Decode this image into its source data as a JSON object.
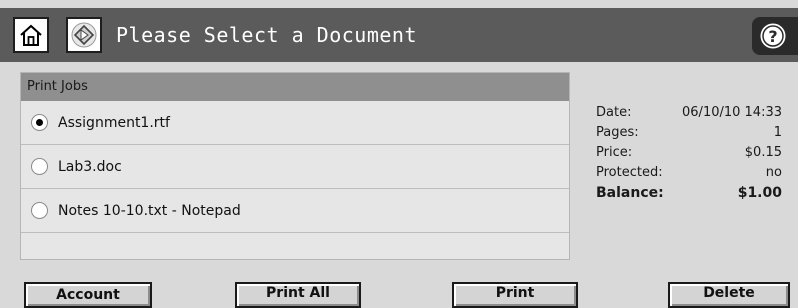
{
  "header": {
    "title": "Please Select a Document",
    "home_icon": "home-icon",
    "start_icon": "start-diamond-icon",
    "help_icon": "help-icon"
  },
  "job_list": {
    "header": "Print Jobs",
    "items": [
      {
        "label": "Assignment1.rtf",
        "selected": true
      },
      {
        "label": "Lab3.doc",
        "selected": false
      },
      {
        "label": "Notes 10-10.txt - Notepad",
        "selected": false
      }
    ]
  },
  "details": {
    "date_label": "Date:",
    "date_value": "06/10/10 14:33",
    "pages_label": "Pages:",
    "pages_value": "1",
    "price_label": "Price:",
    "price_value": "$0.15",
    "protected_label": "Protected:",
    "protected_value": "no",
    "balance_label": "Balance:",
    "balance_value": "$1.00"
  },
  "buttons": {
    "account": "Account",
    "print_all": "Print All",
    "print": "Print",
    "delete": "Delete"
  },
  "colors": {
    "title_bar": "#5b5b5b",
    "list_header": "#8f8f8f",
    "background": "#d9d9d9"
  }
}
